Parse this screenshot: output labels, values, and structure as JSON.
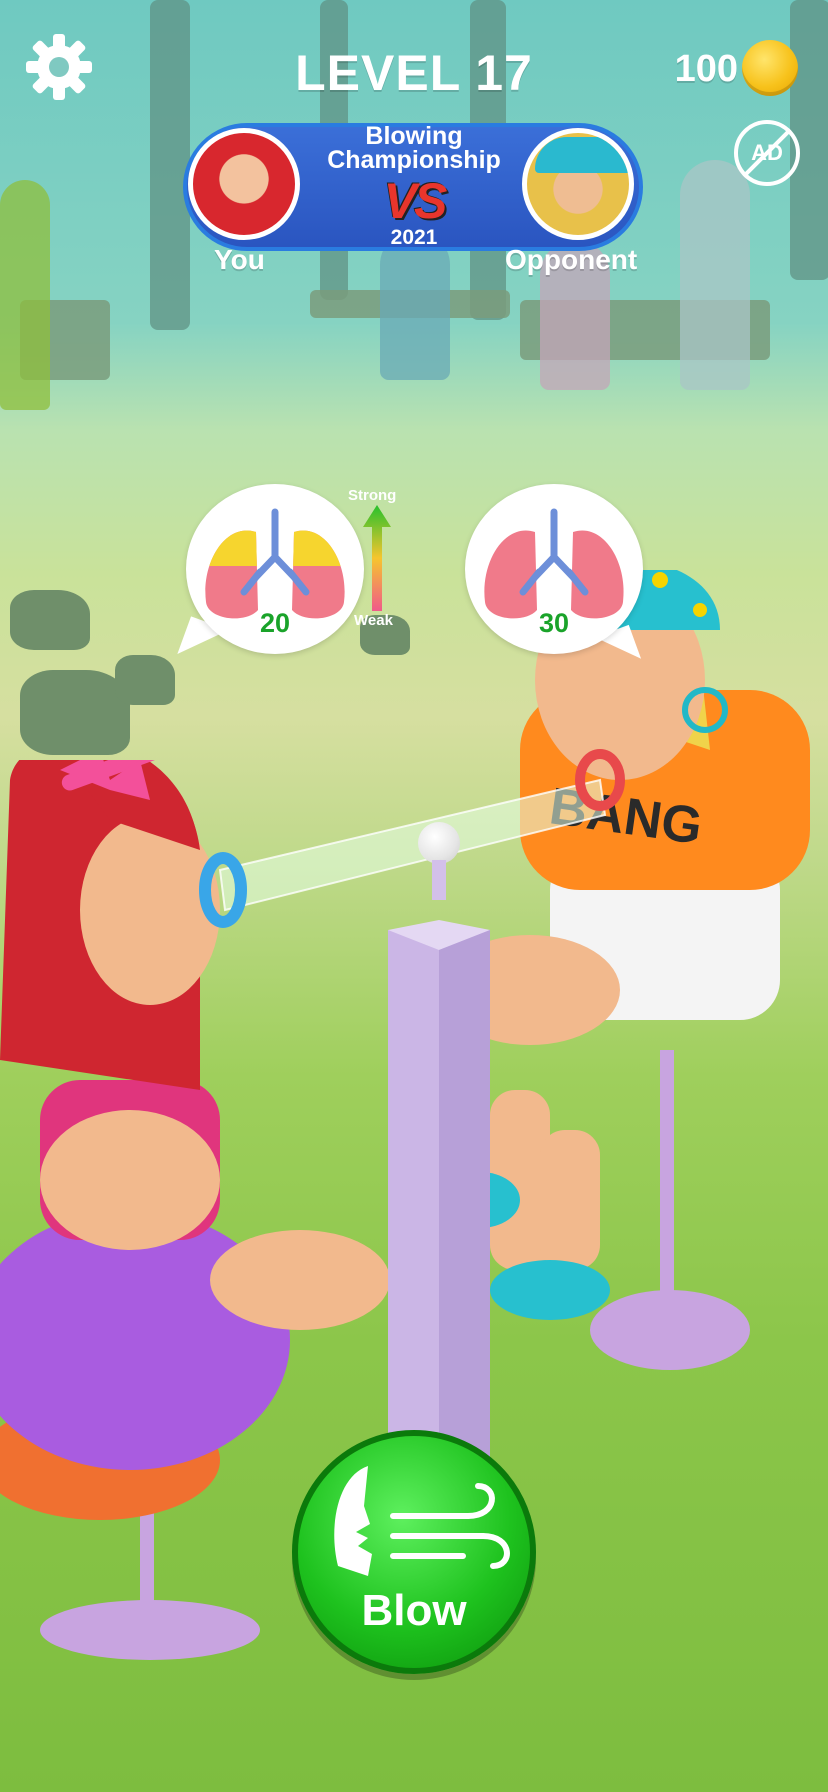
{
  "hud": {
    "level_text": "LEVEL 17",
    "coins": "100"
  },
  "versus": {
    "title_line1": "Blowing",
    "title_line2": "Championship",
    "vs_text": "VS",
    "year": "2021",
    "player_name": "You",
    "opponent_name": "Opponent"
  },
  "lungs": {
    "player_value": "20",
    "opponent_value": "30",
    "meter_top_label": "Strong",
    "meter_bottom_label": "Weak",
    "player_fill_color": "#f6d52e",
    "lung_color": "#f07a8a"
  },
  "ad_badge": "AD",
  "action": {
    "blow_label": "Blow"
  },
  "colors": {
    "coin": "#f7c21b",
    "banner": "#2a55c0",
    "blow_button": "#1ec21e",
    "ring_player": "#39a6e8",
    "ring_opponent": "#e8494b"
  }
}
